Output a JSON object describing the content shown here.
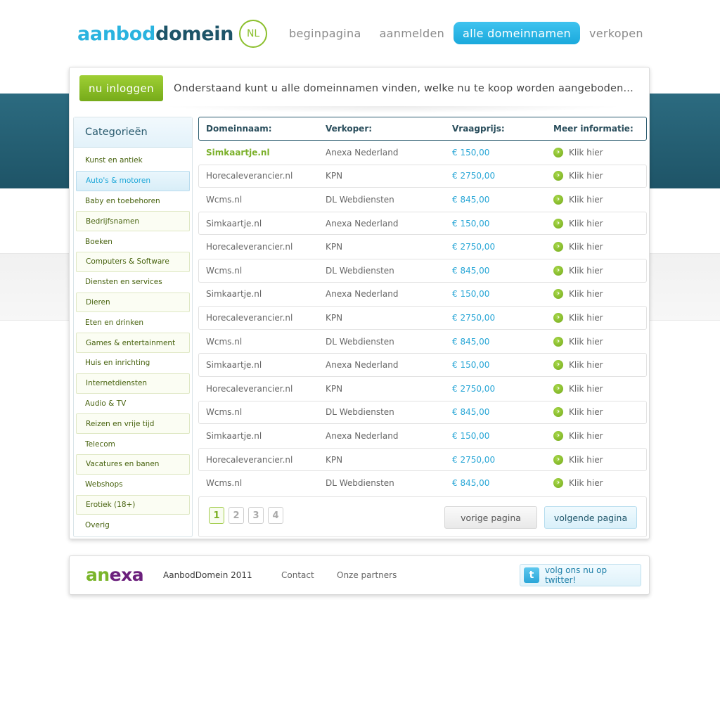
{
  "header": {
    "logo_part1": "aanbod",
    "logo_part2": "domein",
    "logo_badge": "NL",
    "nav": [
      {
        "label": "beginpagina",
        "active": false
      },
      {
        "label": "aanmelden",
        "active": false
      },
      {
        "label": "alle domeinnamen",
        "active": true
      },
      {
        "label": "verkopen",
        "active": false
      }
    ]
  },
  "main": {
    "login_button": "nu inloggen",
    "intro_text": "Onderstaand kunt u alle domeinnamen vinden, welke nu te koop worden aangeboden..."
  },
  "sidebar": {
    "title": "Categorieën",
    "selected": "Auto's & motoren",
    "items": [
      "Kunst en antiek",
      "Auto's & motoren",
      "Baby en toebehoren",
      "Bedrijfsnamen",
      "Boeken",
      "Computers & Software",
      "Diensten en services",
      "Dieren",
      "Eten en drinken",
      "Games & entertainment",
      "Huis en inrichting",
      "Internetdiensten",
      "Audio & TV",
      "Reizen en vrije tijd",
      "Telecom",
      "Vacatures en banen",
      "Webshops",
      "Erotiek (18+)",
      "Overig"
    ]
  },
  "table": {
    "headers": [
      "Domeinnaam:",
      "Verkoper:",
      "Vraagprijs:",
      "Meer informatie:"
    ],
    "link_label": "Klik hier",
    "rows": [
      [
        "Simkaartje.nl",
        "Anexa Nederland",
        "€ 150,00"
      ],
      [
        "Horecaleverancier.nl",
        "KPN",
        "€ 2750,00"
      ],
      [
        "Wcms.nl",
        "DL Webdiensten",
        "€ 845,00"
      ],
      [
        "Simkaartje.nl",
        "Anexa Nederland",
        "€ 150,00"
      ],
      [
        "Horecaleverancier.nl",
        "KPN",
        "€ 2750,00"
      ],
      [
        "Wcms.nl",
        "DL Webdiensten",
        "€ 845,00"
      ],
      [
        "Simkaartje.nl",
        "Anexa Nederland",
        "€ 150,00"
      ],
      [
        "Horecaleverancier.nl",
        "KPN",
        "€ 2750,00"
      ],
      [
        "Wcms.nl",
        "DL Webdiensten",
        "€ 845,00"
      ],
      [
        "Simkaartje.nl",
        "Anexa Nederland",
        "€ 150,00"
      ],
      [
        "Horecaleverancier.nl",
        "KPN",
        "€ 2750,00"
      ],
      [
        "Wcms.nl",
        "DL Webdiensten",
        "€ 845,00"
      ],
      [
        "Simkaartje.nl",
        "Anexa Nederland",
        "€ 150,00"
      ],
      [
        "Horecaleverancier.nl",
        "KPN",
        "€ 2750,00"
      ],
      [
        "Wcms.nl",
        "DL Webdiensten",
        "€ 845,00"
      ]
    ]
  },
  "pagination": {
    "pages": [
      "1",
      "2",
      "3",
      "4"
    ],
    "current": "1",
    "prev_label": "vorige pagina",
    "next_label": "volgende pagina"
  },
  "footer": {
    "partner_logo_part1": "an",
    "partner_logo_part2": "exa",
    "copyright": "AanbodDomein 2011",
    "links": [
      "Contact",
      "Onze partners"
    ],
    "twitter_label": "volg ons nu op twitter!"
  },
  "colors": {
    "accent_blue": "#1aa9dc",
    "accent_green": "#76ab1a",
    "dark_teal": "#1d5468"
  },
  "icons": {
    "row_link": "arrow-right-circle-icon",
    "twitter": "twitter-bird-icon"
  }
}
